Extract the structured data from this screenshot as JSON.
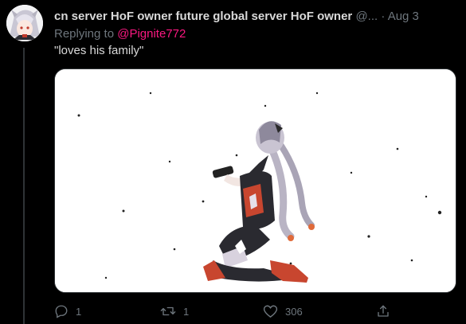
{
  "tweet": {
    "display_name": "cn server HoF owner future global server HoF owner",
    "handle": "@...",
    "separator": "·",
    "date": "Aug 3",
    "replying_prefix": "Replying to ",
    "replying_to": "@Pignite772",
    "text": "\"loves his family\""
  },
  "actions": {
    "reply_count": "1",
    "retweet_count": "1",
    "like_count": "306",
    "reply_icon": "reply-icon",
    "retweet_icon": "retweet-icon",
    "like_icon": "heart-icon",
    "share_icon": "share-icon"
  },
  "colors": {
    "background": "#000000",
    "text": "#d9d9d9",
    "muted": "#6e767d",
    "mention": "#f91880"
  }
}
